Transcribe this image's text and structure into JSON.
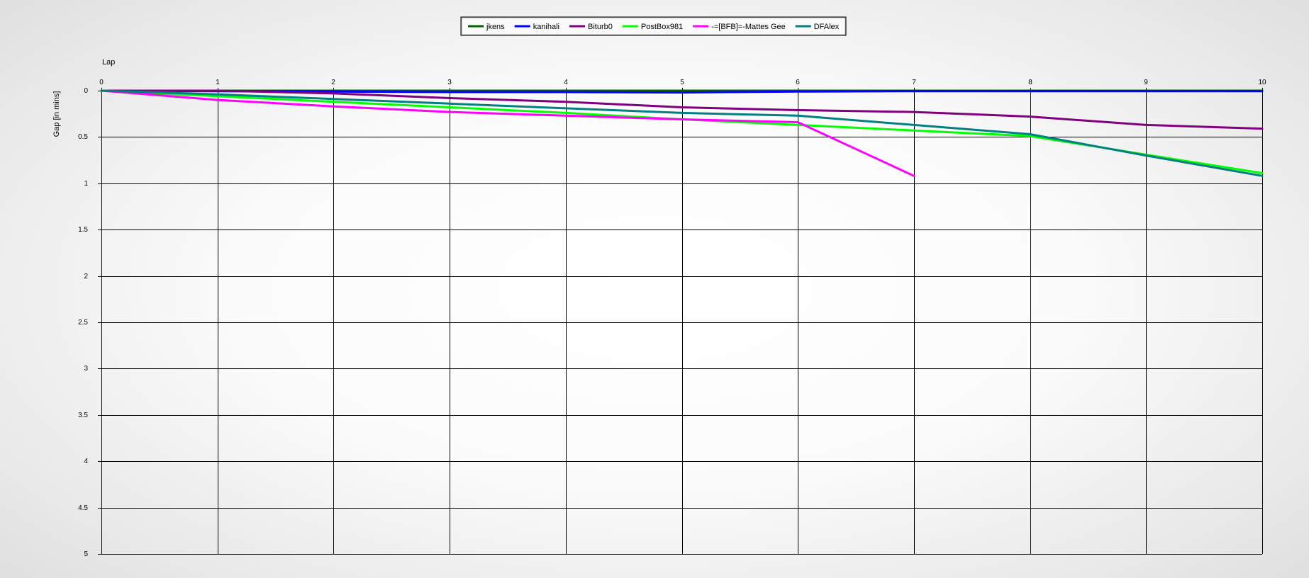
{
  "chart_data": {
    "type": "line",
    "title": "",
    "xlabel": "Lap",
    "ylabel": "Gap [in mins]",
    "xlim": [
      0,
      10
    ],
    "ylim": [
      0,
      5
    ],
    "y_inverted": true,
    "grid": true,
    "legend_position": "top-center",
    "x_ticks": [
      "0",
      "1",
      "2",
      "3",
      "4",
      "5",
      "6",
      "7",
      "8",
      "9",
      "10"
    ],
    "y_ticks": [
      "0",
      "0.5",
      "1",
      "1.5",
      "2",
      "2.5",
      "3",
      "3.5",
      "4",
      "4.5",
      "5"
    ],
    "series": [
      {
        "name": "jkens",
        "color": "#006400",
        "x": [
          0,
          1,
          2,
          3,
          4,
          5,
          6,
          7,
          8,
          9,
          10
        ],
        "y": [
          0,
          0,
          0,
          0,
          0,
          0,
          0,
          0,
          0,
          0,
          0
        ]
      },
      {
        "name": "kanihali",
        "color": "#0000ff",
        "x": [
          0,
          1,
          2,
          3,
          4,
          5,
          6,
          7,
          8,
          9,
          10
        ],
        "y": [
          0,
          0.005,
          0.01,
          0.015,
          0.015,
          0.02,
          0.01,
          0.005,
          0.005,
          0.005,
          0.005
        ]
      },
      {
        "name": "Biturb0",
        "color": "#800080",
        "x": [
          0,
          1,
          2,
          3,
          4,
          5,
          6,
          7,
          8,
          9,
          10
        ],
        "y": [
          0,
          0,
          0.03,
          0.08,
          0.12,
          0.18,
          0.21,
          0.23,
          0.28,
          0.37,
          0.41
        ]
      },
      {
        "name": "PostBox981",
        "color": "#00ff00",
        "x": [
          0,
          1,
          2,
          3,
          4,
          5,
          6,
          7,
          8,
          9,
          10
        ],
        "y": [
          0,
          0.06,
          0.12,
          0.18,
          0.24,
          0.31,
          0.37,
          0.43,
          0.49,
          0.69,
          0.89
        ]
      },
      {
        "name": "-=[BFB]=-Mattes Gee",
        "color": "#ff00ff",
        "x": [
          0,
          1,
          2,
          3,
          4,
          5,
          6,
          7
        ],
        "y": [
          0,
          0.1,
          0.17,
          0.23,
          0.27,
          0.31,
          0.34,
          0.92
        ]
      },
      {
        "name": "DFAlex",
        "color": "#008080",
        "x": [
          0,
          1,
          2,
          3,
          4,
          5,
          6,
          7,
          8,
          9,
          10
        ],
        "y": [
          0,
          0.04,
          0.09,
          0.14,
          0.19,
          0.24,
          0.27,
          0.37,
          0.47,
          0.7,
          0.92
        ]
      }
    ]
  }
}
